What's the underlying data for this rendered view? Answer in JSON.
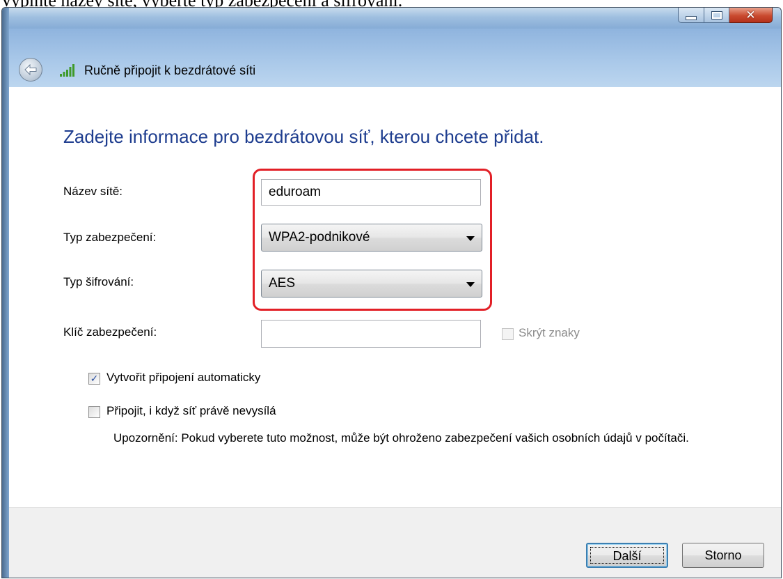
{
  "caption": "Vyplňte název sítě, vyberte typ zabezpečení a šifrování.",
  "window": {
    "title": "Ručně připojit k bezdrátové síti",
    "controls": {
      "minimize": "minimize-icon",
      "maximize": "maximize-icon",
      "close": "close-icon"
    }
  },
  "heading": "Zadejte informace pro bezdrátovou síť, kterou chcete přidat.",
  "form": {
    "network_name_label": "Název sítě:",
    "network_name_value": "eduroam",
    "security_type_label": "Typ zabezpečení:",
    "security_type_value": "WPA2-podnikové",
    "encryption_type_label": "Typ šifrování:",
    "encryption_type_value": "AES",
    "security_key_label": "Klíč zabezpečení:",
    "security_key_value": "",
    "hide_chars_label": "Skrýt znaky",
    "hide_chars_checked": false,
    "auto_connect_label": "Vytvořit připojení automaticky",
    "auto_connect_checked": true,
    "connect_hidden_label": "Připojit, i když síť právě nevysílá",
    "connect_hidden_checked": false,
    "warning": "Upozornění: Pokud vyberete tuto možnost, může být ohroženo zabezpečení vašich osobních údajů v počítači."
  },
  "buttons": {
    "next": "Další",
    "cancel": "Storno"
  },
  "colors": {
    "heading": "#1e3d8f",
    "highlight": "#e21f26",
    "checkmark": "#2a4fa0"
  }
}
